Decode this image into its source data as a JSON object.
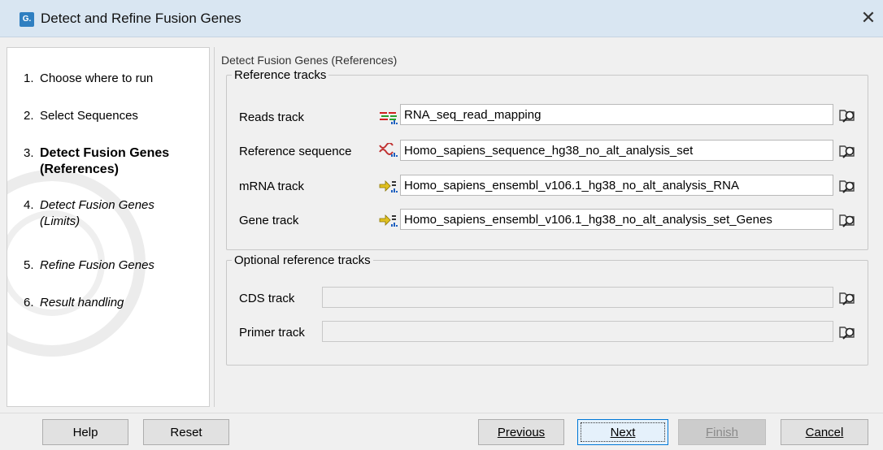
{
  "window": {
    "title": "Detect and Refine Fusion Genes",
    "icon_label": "G."
  },
  "steps": [
    {
      "num": "1.",
      "label": "Choose where to run",
      "state": "done"
    },
    {
      "num": "2.",
      "label": "Select Sequences",
      "state": "done"
    },
    {
      "num": "3.",
      "label": "Detect Fusion Genes (References)",
      "state": "current"
    },
    {
      "num": "4.",
      "label": "Detect Fusion Genes (Limits)",
      "state": "future"
    },
    {
      "num": "5.",
      "label": "Refine Fusion Genes",
      "state": "future"
    },
    {
      "num": "6.",
      "label": "Result handling",
      "state": "future"
    }
  ],
  "main": {
    "section_title": "Detect Fusion Genes (References)",
    "reference_tracks": {
      "legend": "Reference tracks",
      "rows": [
        {
          "label": "Reads track",
          "value": "RNA_seq_read_mapping",
          "icon": "reads-track-icon"
        },
        {
          "label": "Reference sequence",
          "value": "Homo_sapiens_sequence_hg38_no_alt_analysis_set",
          "icon": "sequence-track-icon"
        },
        {
          "label": "mRNA track",
          "value": "Homo_sapiens_ensembl_v106.1_hg38_no_alt_analysis_RNA",
          "icon": "annotation-track-icon"
        },
        {
          "label": "Gene track",
          "value": "Homo_sapiens_ensembl_v106.1_hg38_no_alt_analysis_set_Genes",
          "icon": "annotation-track-icon"
        }
      ]
    },
    "optional_tracks": {
      "legend": "Optional reference tracks",
      "rows": [
        {
          "label": "CDS track",
          "value": ""
        },
        {
          "label": "Primer track",
          "value": ""
        }
      ]
    }
  },
  "buttons": {
    "help": "Help",
    "reset": "Reset",
    "previous": "Previous",
    "next": "Next",
    "finish": "Finish",
    "cancel": "Cancel"
  },
  "colors": {
    "titlebar": "#d9e6f2",
    "panel": "#f0f0f0",
    "default_button_border": "#0078d7"
  }
}
